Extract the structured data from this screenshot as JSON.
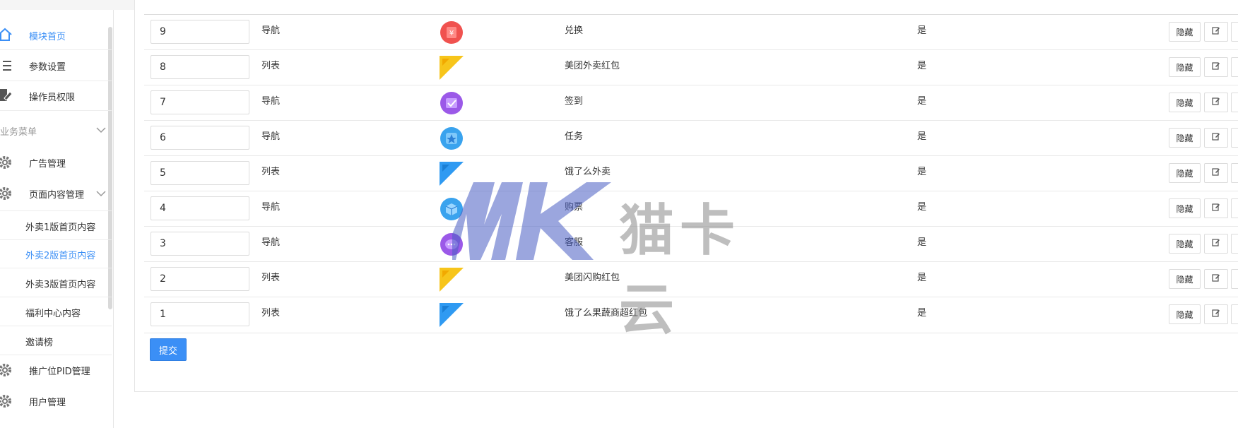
{
  "sidebar": {
    "items": [
      {
        "label": "模块首页",
        "icon": "home-icon",
        "active": true
      },
      {
        "label": "参数设置",
        "icon": "list-settings-icon"
      },
      {
        "label": "操作员权限",
        "icon": "edit-document-icon"
      },
      {
        "label": "业务菜单",
        "group": true
      },
      {
        "label": "广告管理",
        "icon": "gear-icon"
      },
      {
        "label": "页面内容管理",
        "icon": "gear-icon",
        "expanded": true
      },
      {
        "label": "外卖1版首页内容",
        "sub": true
      },
      {
        "label": "外卖2版首页内容",
        "sub": true,
        "active": true
      },
      {
        "label": "外卖3版首页内容",
        "sub": true
      },
      {
        "label": "福利中心内容",
        "sub": true
      },
      {
        "label": "邀请榜",
        "sub": true
      },
      {
        "label": "推广位PID管理",
        "icon": "gear-icon"
      },
      {
        "label": "用户管理",
        "icon": "gear-icon"
      }
    ]
  },
  "table": {
    "rows": [
      {
        "sort": "9",
        "type": "导航",
        "icon": "coupon-red-icon",
        "name": "兑换",
        "show": "是"
      },
      {
        "sort": "8",
        "type": "列表",
        "icon": "meituan-corner-icon",
        "name": "美团外卖红包",
        "show": "是"
      },
      {
        "sort": "7",
        "type": "导航",
        "icon": "checkin-purple-icon",
        "name": "签到",
        "show": "是"
      },
      {
        "sort": "6",
        "type": "导航",
        "icon": "star-blue-icon",
        "name": "任务",
        "show": "是"
      },
      {
        "sort": "5",
        "type": "列表",
        "icon": "eleme-corner-icon",
        "name": "饿了么外卖",
        "show": "是"
      },
      {
        "sort": "4",
        "type": "导航",
        "icon": "cube-blue-icon",
        "name": "购票",
        "show": "是"
      },
      {
        "sort": "3",
        "type": "导航",
        "icon": "chat-purple-icon",
        "name": "客服",
        "show": "是"
      },
      {
        "sort": "2",
        "type": "列表",
        "icon": "meituan-corner-icon",
        "name": "美团闪购红包",
        "show": "是"
      },
      {
        "sort": "1",
        "type": "列表",
        "icon": "eleme-corner-icon",
        "name": "饿了么果蔬商超红包",
        "show": "是"
      }
    ],
    "hide_label": "隐藏"
  },
  "submit_label": "提交",
  "watermark": {
    "text": "猫卡云"
  },
  "colors": {
    "accent": "#3b8ff6"
  }
}
